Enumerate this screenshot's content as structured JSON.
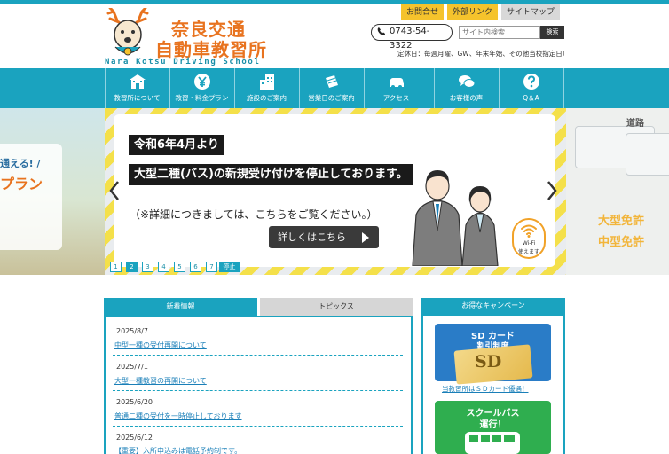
{
  "header": {
    "logo_line1": "奈良交通",
    "logo_line2": "自動車教習所",
    "logo_en": "Nara Kotsu Driving School",
    "top_links": [
      "お問合せ",
      "外部リンク",
      "サイトマップ"
    ],
    "tel": "0743-54-3322",
    "search_placeholder": "サイト内検索",
    "search_button": "検索",
    "holiday_note": "定休日：毎週月曜、GW、年末年始、その他当校指定日）"
  },
  "nav": {
    "items": [
      {
        "label": "教習所について",
        "icon": "school-icon"
      },
      {
        "label": "教習・料金プラン",
        "icon": "yen-icon"
      },
      {
        "label": "施設のご案内",
        "icon": "building-icon"
      },
      {
        "label": "営業日のご案内",
        "icon": "calendar-icon"
      },
      {
        "label": "アクセス",
        "icon": "car-icon"
      },
      {
        "label": "お客様の声",
        "icon": "speech-bubble-icon"
      },
      {
        "label": "Q＆A",
        "icon": "question-icon"
      }
    ]
  },
  "hero": {
    "left_text1": "通える! /",
    "left_text2": "プラン",
    "right_text1": "大型免許",
    "right_text2": "中型免許",
    "right_sign": "道路",
    "headline1": "令和6年4月より",
    "headline2": "大型二種(バス)の新規受け付けを停止しております。",
    "note": "（※詳細につきましては、こちらをご覧ください。）",
    "button": "詳しくはこちら",
    "wifi_line1": "Wi-Fi",
    "wifi_line2": "使えます",
    "pages": [
      "1",
      "2",
      "3",
      "4",
      "5",
      "6",
      "7"
    ],
    "active_page": 2,
    "stop_label": "停止"
  },
  "news": {
    "tab_news": "新着情報",
    "tab_topics": "トピックス",
    "items": [
      {
        "date": "2025/8/7",
        "title": "中型一種の受付再開について"
      },
      {
        "date": "2025/7/1",
        "title": "大型一種教習の再開について"
      },
      {
        "date": "2025/6/20",
        "title": "普通二種の受付を一時停止しております"
      },
      {
        "date": "2025/6/12",
        "title": "【重要】入所申込みは電話予約制です。"
      }
    ]
  },
  "campaign": {
    "heading": "お得なキャンペーン",
    "sd_title1": "SD カード",
    "sd_title2": "割引制度",
    "sd_card": "SD",
    "sd_caption": "当教習所はＳＤカード優遇！",
    "bus_title1": "スクールバス",
    "bus_title2": "運行！"
  },
  "colors": {
    "primary": "#1aa3bf",
    "accent_orange": "#e8731f",
    "accent_yellow": "#f5c32c",
    "link": "#1a7fb8"
  }
}
